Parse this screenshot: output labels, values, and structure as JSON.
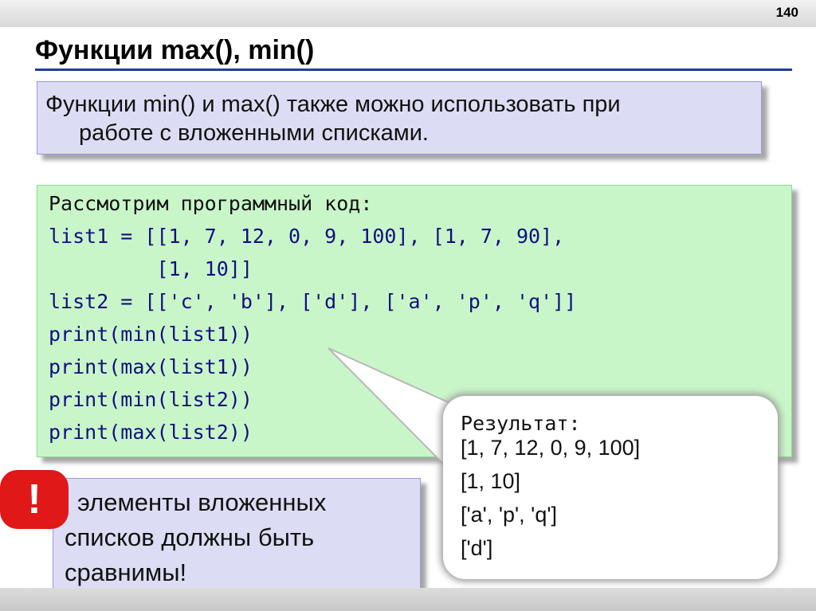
{
  "slide": {
    "page_number": "140",
    "title": "Функции max(), min()"
  },
  "intro": {
    "line1": "Функции min() и max() также можно использовать при",
    "line2": "работе с вложенными списками."
  },
  "code": {
    "caption": "Рассмотрим программный код:",
    "lines": [
      "list1 = [[1, 7, 12, 0, 9, 100], [1, 7, 90],",
      "         [1, 10]]",
      "list2 = [['c', 'b'], ['d'], ['a', 'p', 'q']]",
      "print(min(list1))",
      "print(max(list1))",
      "print(min(list2))",
      "print(max(list2))"
    ]
  },
  "result": {
    "label": "Результат:",
    "lines": [
      "[1, 7, 12, 0, 9, 100]",
      "[1, 10]",
      "['a', 'p', 'q']",
      "['d']"
    ]
  },
  "note": {
    "badge": "!",
    "line1": "элементы вложенных",
    "line2": "списков  должны быть",
    "line3": "сравнимы!"
  },
  "colors": {
    "accent_rule": "#1f3f9f",
    "intro_background": "#dcdcf4",
    "code_background": "#c9f6c9",
    "code_text": "#101080",
    "warning_badge": "#e01818"
  }
}
